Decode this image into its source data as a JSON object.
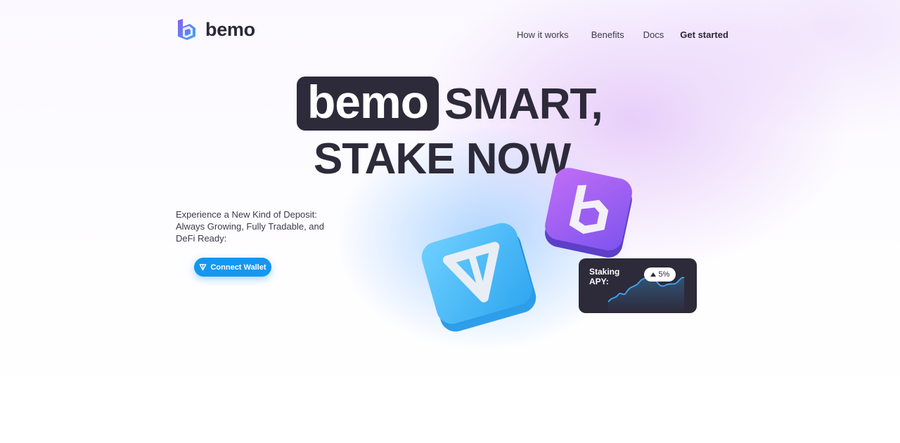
{
  "brand": {
    "name": "bemo",
    "colors": {
      "primary_dark": "#2d2a3a",
      "accent_blue": "#1597ef",
      "logo_purple": "#8a5cf5",
      "logo_blue": "#3aa8f5"
    }
  },
  "nav": {
    "items": [
      {
        "label": "How it works"
      },
      {
        "label": "Benefits"
      },
      {
        "label": "Docs"
      },
      {
        "label": "Get started"
      }
    ]
  },
  "hero": {
    "highlight": "bemo",
    "line1": "SMART,",
    "line2": "STAKE NOW",
    "description": "Experience a New Kind of Deposit: Always Growing, Fully Tradable, and DeFi Ready:",
    "cta_label": "Connect Wallet",
    "cta_icon": "ton-icon"
  },
  "staking_card": {
    "label": "Staking APY:",
    "value": "5%",
    "icon": "arrow-up-icon"
  },
  "tiles": [
    {
      "icon": "ton-logo-icon",
      "color": "#3fb3f5"
    },
    {
      "icon": "bemo-logo-icon",
      "color": "#a05cf0"
    }
  ]
}
